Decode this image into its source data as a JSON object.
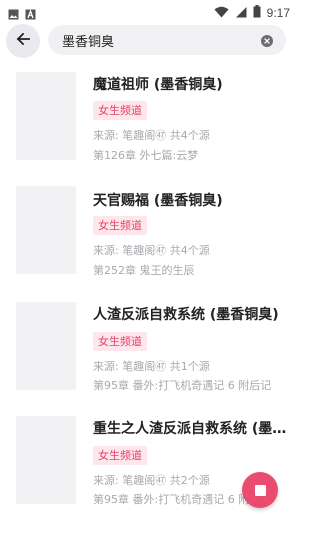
{
  "status_bar": {
    "time": "9:17"
  },
  "search": {
    "query": "墨香铜臭"
  },
  "results": [
    {
      "title": "魔道祖师 (墨香铜臭)",
      "tag": "女生频道",
      "source": "来源: 笔趣阁㊼ 共4个源",
      "latest": "第126章 外七篇:云梦"
    },
    {
      "title": "天官赐福 (墨香铜臭)",
      "tag": "女生频道",
      "source": "来源: 笔趣阁㊼ 共4个源",
      "latest": "第252章 鬼王的生辰"
    },
    {
      "title": "人渣反派自救系统 (墨香铜臭)",
      "tag": "女生频道",
      "source": "来源: 笔趣阁㊼ 共1个源",
      "latest": "第95章 番外:打飞机奇遇记 6 附后记"
    },
    {
      "title": "重生之人渣反派自救系统 (墨香铜臭)",
      "tag": "女生频道",
      "source": "来源: 笔趣阁㊼ 共2个源",
      "latest": "第95章 番外:打飞机奇遇记 6 附后记"
    }
  ],
  "colors": {
    "accent": "#ea4c6f",
    "tag_bg": "#fde7ec",
    "tag_text": "#e8436a",
    "meta_text": "#a9a9ae"
  },
  "icons": [
    "image-icon",
    "text-notification-icon",
    "wifi-icon",
    "signal-icon",
    "battery-icon",
    "back-arrow-icon",
    "clear-icon",
    "stop-icon"
  ]
}
